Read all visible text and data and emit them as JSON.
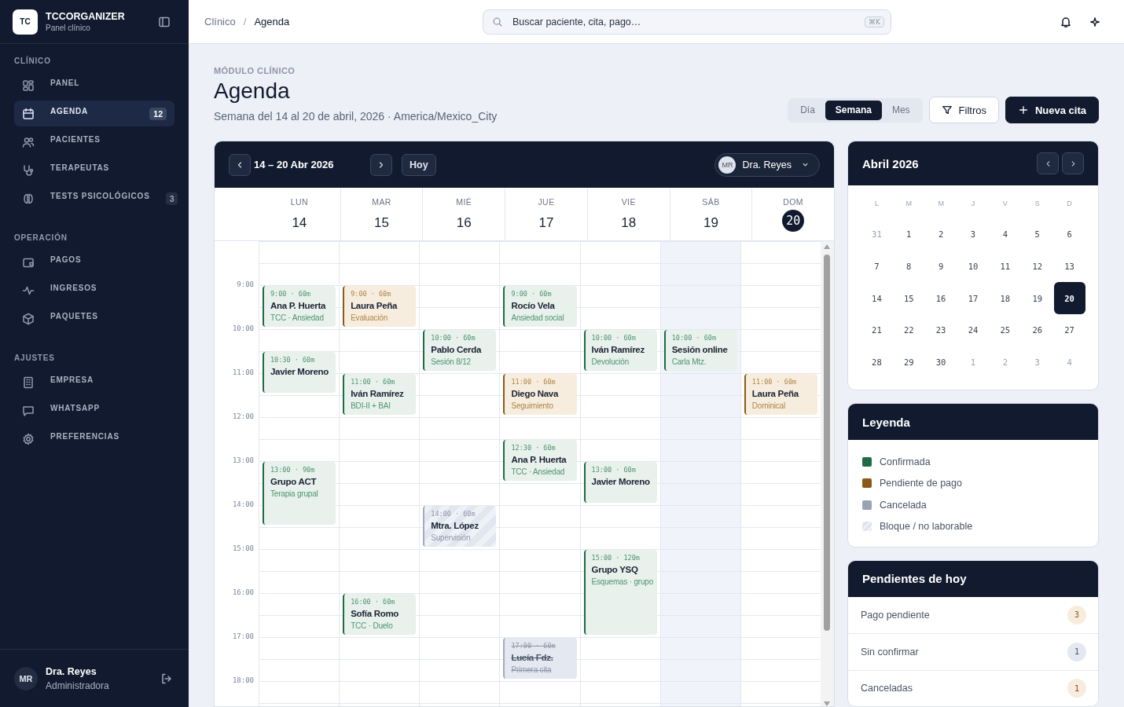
{
  "sidebar": {
    "logo": "TC",
    "app_name": "TCCORGANIZER",
    "app_subtitle": "Panel clínico",
    "sections": [
      {
        "title": "CLÍNICO",
        "items": [
          {
            "label": "PANEL",
            "selected": false
          },
          {
            "label": "AGENDA",
            "selected": true,
            "badge": "12"
          },
          {
            "label": "PACIENTES",
            "selected": false
          },
          {
            "label": "TERAPEUTAS",
            "selected": false
          },
          {
            "label": "TESTS PSICOLÓGICOS",
            "selected": false,
            "badge": "3"
          }
        ]
      },
      {
        "title": "OPERACIÓN",
        "items": [
          {
            "label": "PAGOS",
            "selected": false
          },
          {
            "label": "INGRESOS",
            "selected": false
          },
          {
            "label": "PAQUETES",
            "selected": false
          }
        ]
      },
      {
        "title": "AJUSTES",
        "items": [
          {
            "label": "EMPRESA",
            "selected": false
          },
          {
            "label": "WHATSAPP",
            "selected": false
          },
          {
            "label": "PREFERENCIAS",
            "selected": false
          }
        ]
      }
    ],
    "user": {
      "initials": "MR",
      "name": "Dra. Reyes",
      "role": "Administradora"
    }
  },
  "topbar": {
    "breadcrumb": [
      "Clínico",
      "Agenda"
    ],
    "separator": "/",
    "search": {
      "placeholder": "Buscar paciente, cita, pago…",
      "shortcut": "⌘K"
    }
  },
  "page": {
    "eyebrow": "MÓDULO CLÍNICO",
    "title": "Agenda",
    "subtitle": "Semana del 14 al 20 de abril, 2026 · America/Mexico_City",
    "views": [
      {
        "label": "Día",
        "selected": false
      },
      {
        "label": "Semana",
        "selected": true
      },
      {
        "label": "Mes",
        "selected": false
      }
    ],
    "filter_button": "Filtros",
    "new_button": "Nueva cita"
  },
  "calendar": {
    "range": "14 – 20 Abr 2026",
    "today_button": "Hoy",
    "therapist": {
      "initials": "MR",
      "name": "Dra. Reyes"
    },
    "hours": [
      "9:00",
      "10:00",
      "11:00",
      "12:00",
      "13:00",
      "14:00",
      "15:00",
      "16:00",
      "17:00",
      "18:00"
    ],
    "days": [
      {
        "dow": "LUN",
        "date": "14",
        "today": false,
        "shaded": false,
        "events": [
          {
            "kind": "confirmed",
            "time": "9:00 · 60m",
            "name": "Ana P. Huerta",
            "detail": "TCC · Ansiedad"
          },
          {
            "kind": "confirmed",
            "time": "10:30 · 60m",
            "name": "Javier Moreno"
          },
          {
            "kind": "confirmed",
            "time": "13:00 · 90m",
            "name": "Grupo ACT",
            "detail": "Terapia grupal"
          }
        ]
      },
      {
        "dow": "MAR",
        "date": "15",
        "today": false,
        "shaded": false,
        "events": [
          {
            "kind": "pending",
            "time": "9:00 · 60m",
            "name": "Laura Peña",
            "detail": "Evaluación"
          },
          {
            "kind": "confirmed",
            "time": "11:00 · 60m",
            "name": "Iván Ramírez",
            "detail": "BDI-II + BAI"
          },
          {
            "kind": "confirmed",
            "time": "16:00 · 60m",
            "name": "Sofía Romo",
            "detail": "TCC · Duelo"
          }
        ]
      },
      {
        "dow": "MIÉ",
        "date": "16",
        "today": false,
        "shaded": false,
        "events": [
          {
            "kind": "confirmed",
            "time": "10:00 · 60m",
            "name": "Pablo Cerda",
            "detail": "Sesión 8/12"
          },
          {
            "kind": "block",
            "time": "14:00 · 60m",
            "name": "Mtra. López",
            "detail": "Supervisión"
          }
        ]
      },
      {
        "dow": "JUE",
        "date": "17",
        "today": false,
        "shaded": false,
        "events": [
          {
            "kind": "confirmed",
            "time": "9:00 · 60m",
            "name": "Rocío Vela",
            "detail": "Ansiedad social"
          },
          {
            "kind": "pending",
            "time": "11:00 · 60m",
            "name": "Diego Nava",
            "detail": "Seguimiento"
          },
          {
            "kind": "confirmed",
            "time": "12:30 · 60m",
            "name": "Ana P. Huerta",
            "detail": "TCC · Ansiedad"
          },
          {
            "kind": "cancelled",
            "time": "17:00 · 60m",
            "name": "Lucía Fdz.",
            "detail": "Primera cita"
          }
        ]
      },
      {
        "dow": "VIE",
        "date": "18",
        "today": false,
        "shaded": false,
        "events": [
          {
            "kind": "confirmed",
            "time": "10:00 · 60m",
            "name": "Iván Ramírez",
            "detail": "Devolución"
          },
          {
            "kind": "confirmed",
            "time": "13:00 · 60m",
            "name": "Javier Moreno"
          },
          {
            "kind": "confirmed",
            "time": "15:00 · 120m",
            "name": "Grupo YSQ",
            "detail": "Esquemas · grupo"
          }
        ]
      },
      {
        "dow": "SÁB",
        "date": "19",
        "today": false,
        "shaded": true,
        "events": [
          {
            "kind": "confirmed",
            "time": "10:00 · 60m",
            "name": "Sesión online",
            "detail": "Carla Mtz."
          }
        ]
      },
      {
        "dow": "DOM",
        "date": "20",
        "today": true,
        "shaded": false,
        "events": [
          {
            "kind": "pending",
            "time": "11:00 · 60m",
            "name": "Laura Peña",
            "detail": "Dominical"
          }
        ]
      }
    ]
  },
  "mini_calendar": {
    "title": "Abril 2026",
    "weekdays": [
      "L",
      "M",
      "M",
      "J",
      "V",
      "S",
      "D"
    ],
    "weeks": [
      [
        {
          "label": "31",
          "outside": true,
          "selected": false
        },
        {
          "label": "1",
          "outside": false,
          "selected": false
        },
        {
          "label": "2",
          "outside": false,
          "selected": false
        },
        {
          "label": "3",
          "outside": false,
          "selected": false
        },
        {
          "label": "4",
          "outside": false,
          "selected": false
        },
        {
          "label": "5",
          "outside": false,
          "selected": false
        },
        {
          "label": "6",
          "outside": false,
          "selected": false
        }
      ],
      [
        {
          "label": "7",
          "outside": false,
          "selected": false
        },
        {
          "label": "8",
          "outside": false,
          "selected": false
        },
        {
          "label": "9",
          "outside": false,
          "selected": false
        },
        {
          "label": "10",
          "outside": false,
          "selected": false
        },
        {
          "label": "11",
          "outside": false,
          "selected": false
        },
        {
          "label": "12",
          "outside": false,
          "selected": false
        },
        {
          "label": "13",
          "outside": false,
          "selected": false
        }
      ],
      [
        {
          "label": "14",
          "outside": false,
          "selected": false
        },
        {
          "label": "15",
          "outside": false,
          "selected": false
        },
        {
          "label": "16",
          "outside": false,
          "selected": false
        },
        {
          "label": "17",
          "outside": false,
          "selected": false
        },
        {
          "label": "18",
          "outside": false,
          "selected": false
        },
        {
          "label": "19",
          "outside": false,
          "selected": false
        },
        {
          "label": "20",
          "outside": false,
          "selected": true
        }
      ],
      [
        {
          "label": "21",
          "outside": false,
          "selected": false
        },
        {
          "label": "22",
          "outside": false,
          "selected": false
        },
        {
          "label": "23",
          "outside": false,
          "selected": false
        },
        {
          "label": "24",
          "outside": false,
          "selected": false
        },
        {
          "label": "25",
          "outside": false,
          "selected": false
        },
        {
          "label": "26",
          "outside": false,
          "selected": false
        },
        {
          "label": "27",
          "outside": false,
          "selected": false
        }
      ],
      [
        {
          "label": "28",
          "outside": false,
          "selected": false
        },
        {
          "label": "29",
          "outside": false,
          "selected": false
        },
        {
          "label": "30",
          "outside": false,
          "selected": false
        },
        {
          "label": "1",
          "outside": true,
          "selected": false
        },
        {
          "label": "2",
          "outside": true,
          "selected": false
        },
        {
          "label": "3",
          "outside": true,
          "selected": false
        },
        {
          "label": "4",
          "outside": true,
          "selected": false
        }
      ]
    ]
  },
  "legend": {
    "title": "Leyenda",
    "items": [
      {
        "kind": "confirmed",
        "label": "Confirmada"
      },
      {
        "kind": "pending",
        "label": "Pendiente de pago"
      },
      {
        "kind": "cancelled",
        "label": "Cancelada"
      },
      {
        "kind": "block",
        "label": "Bloque / no laborable"
      }
    ]
  },
  "pending_today": {
    "title": "Pendientes de hoy",
    "items": [
      {
        "kind": "pending",
        "label": "Pago pendiente",
        "count": "3"
      },
      {
        "kind": "neutral",
        "label": "Sin confirmar",
        "count": "1"
      },
      {
        "kind": "cancelled",
        "label": "Canceladas",
        "count": "1"
      }
    ]
  }
}
